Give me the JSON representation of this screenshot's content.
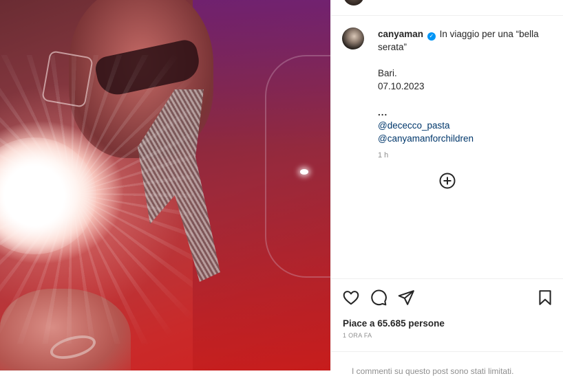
{
  "post": {
    "username": "canyaman",
    "verified_symbol": "✓",
    "caption_text": "In viaggio per una “bella serata”",
    "location_line": "Bari.",
    "date_line": "07.10.2023",
    "dots": "...",
    "mentions": [
      "@dececco_pasta",
      "@canyamanforchildren"
    ],
    "time_ago": "1 h"
  },
  "actions": {
    "like_icon": "heart-icon",
    "comment_icon": "comment-icon",
    "share_icon": "share-icon",
    "save_icon": "bookmark-icon",
    "add_icon": "plus-circle-icon"
  },
  "likes": {
    "text": "Piace a 65.685 persone"
  },
  "posted_ago": "1 ORA FA",
  "comments_limited_text": "I commenti su questo post sono stati limitati.",
  "colors": {
    "verified": "#0095f6",
    "mention": "#00376b",
    "muted": "#8e8e8e",
    "text": "#262626"
  }
}
